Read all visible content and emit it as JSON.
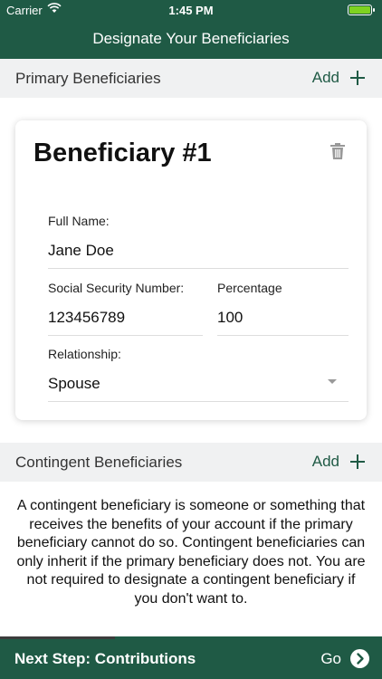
{
  "status_bar": {
    "carrier": "Carrier",
    "time": "1:45 PM"
  },
  "nav": {
    "title": "Designate Your Beneficiaries"
  },
  "primary_section": {
    "label": "Primary Beneficiaries",
    "add_label": "Add"
  },
  "beneficiary_card": {
    "title": "Beneficiary #1",
    "full_name_label": "Full Name:",
    "full_name_value": "Jane Doe",
    "ssn_label": "Social Security Number:",
    "ssn_value": "123456789",
    "percentage_label": "Percentage",
    "percentage_value": "100",
    "relationship_label": "Relationship:",
    "relationship_value": "Spouse"
  },
  "contingent_section": {
    "label": "Contingent Beneficiaries",
    "add_label": "Add",
    "description": "A contingent beneficiary is someone or something that receives the benefits of your account if the primary beneficiary cannot do so. Contingent beneficiaries can only inherit if the primary beneficiary does not. You are not required to designate a contingent beneficiary if you don't want to."
  },
  "footer": {
    "next_label": "Next Step: Contributions",
    "go_label": "Go",
    "progress": 0.3
  },
  "icons": [
    "wifi-icon",
    "battery-icon",
    "plus-icon",
    "trash-icon",
    "chevron-down-icon",
    "arrow-right-circle-icon"
  ],
  "colors": {
    "brand_green": "#1f5a45",
    "section_bg": "#f0f1f2"
  }
}
